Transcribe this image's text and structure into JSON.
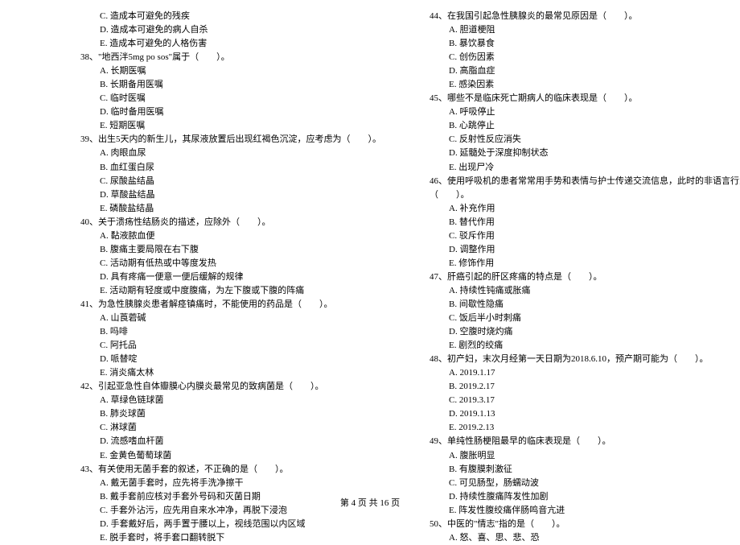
{
  "left": {
    "pre_options": [
      "C. 造成本可避免的残疾",
      "D. 造成本可避免的病人自杀",
      "E. 造成本可避免的人格伤害"
    ],
    "q38": {
      "stem": "38、\"地西泮5mg po sos\"属于（　　）。",
      "options": [
        "A. 长期医嘱",
        "B. 长期备用医嘱",
        "C. 临时医嘱",
        "D. 临时备用医嘱",
        "E. 短期医嘱"
      ]
    },
    "q39": {
      "stem": "39、出生5天内的新生儿，其尿液放置后出现红褐色沉淀，应考虑为（　　）。",
      "options": [
        "A. 肉眼血尿",
        "B. 血红蛋白尿",
        "C. 尿酸盐结晶",
        "D. 草酸盐结晶",
        "E. 磷酸盐结晶"
      ]
    },
    "q40": {
      "stem": "40、关于溃疡性结肠炎的描述，应除外（　　）。",
      "options": [
        "A. 黏液脓血便",
        "B. 腹痛主要局限在右下腹",
        "C. 活动期有低热或中等度发热",
        "D. 具有疼痛一便意一便后缓解的规律",
        "E. 活动期有轻度或中度腹痛，为左下腹或下腹的阵痛"
      ]
    },
    "q41": {
      "stem": "41、为急性胰腺炎患者解痉镇痛时，不能使用的药品是（　　）。",
      "options": [
        "A. 山莨菪碱",
        "B. 吗啡",
        "C. 阿托品",
        "D. 哌替啶",
        "E. 消炎痛太林"
      ]
    },
    "q42": {
      "stem": "42、引起亚急性自体瓣膜心内膜炎最常见的致病菌是（　　）。",
      "options": [
        "A. 草绿色链球菌",
        "B. 肺炎球菌",
        "C. 淋球菌",
        "D. 流感嗜血杆菌",
        "E. 金黄色葡萄球菌"
      ]
    },
    "q43": {
      "stem": "43、有关使用无菌手套的叙述，不正确的是（　　）。",
      "options": [
        "A. 戴无菌手套时，应先将手洗净擦干",
        "B. 戴手套前应核对手套外号码和灭菌日期",
        "C. 手套外沾污，应先用自来水冲净，再脱下浸泡",
        "D. 手套戴好后，两手置于腰以上，视线范围以内区域",
        "E. 脱手套时，将手套口翻转脱下"
      ]
    }
  },
  "right": {
    "q44": {
      "stem": "44、在我国引起急性胰腺炎的最常见原因是（　　）。",
      "options": [
        "A. 胆道梗阻",
        "B. 暴饮暴食",
        "C. 创伤因素",
        "D. 高脂血症",
        "E. 感染因素"
      ]
    },
    "q45": {
      "stem": "45、哪些不是临床死亡期病人的临床表现是（　　）。",
      "options": [
        "A. 呼吸停止",
        "B. 心跳停止",
        "C. 反射性反应消失",
        "D. 延髓处于深度抑制状态",
        "E. 出现尸冷"
      ]
    },
    "q46": {
      "stem": "46、使用呼吸机的患者常常用手势和表情与护士传递交流信息，此时的非语言行为对语言具有",
      "cont": "（　　）。",
      "options": [
        "A. 补充作用",
        "B. 替代作用",
        "C. 驳斥作用",
        "D. 调整作用",
        "E. 修饰作用"
      ]
    },
    "q47": {
      "stem": "47、肝癌引起的肝区疼痛的特点是（　　）。",
      "options": [
        "A. 持续性钝痛或胀痛",
        "B. 间歇性隐痛",
        "C. 饭后半小时刺痛",
        "D. 空腹时烧灼痛",
        "E. 剧烈的绞痛"
      ]
    },
    "q48": {
      "stem": "48、初产妇，末次月经第一天日期为2018.6.10，预产期可能为（　　）。",
      "options": [
        "A. 2019.1.17",
        "B. 2019.2.17",
        "C. 2019.3.17",
        "D. 2019.1.13",
        "E. 2019.2.13"
      ]
    },
    "q49": {
      "stem": "49、单纯性肠梗阻最早的临床表现是（　　）。",
      "options": [
        "A. 腹胀明显",
        "B. 有腹膜刺激征",
        "C. 可见肠型，肠蠕动波",
        "D. 持续性腹痛阵发性加剧",
        "E. 阵发性腹绞痛伴肠鸣音亢进"
      ]
    },
    "q50": {
      "stem": "50、中医的\"情志\"指的是（　　）。",
      "options": [
        "A. 怒、喜、思、悲、恐"
      ]
    }
  },
  "footer": "第 4 页 共 16 页"
}
